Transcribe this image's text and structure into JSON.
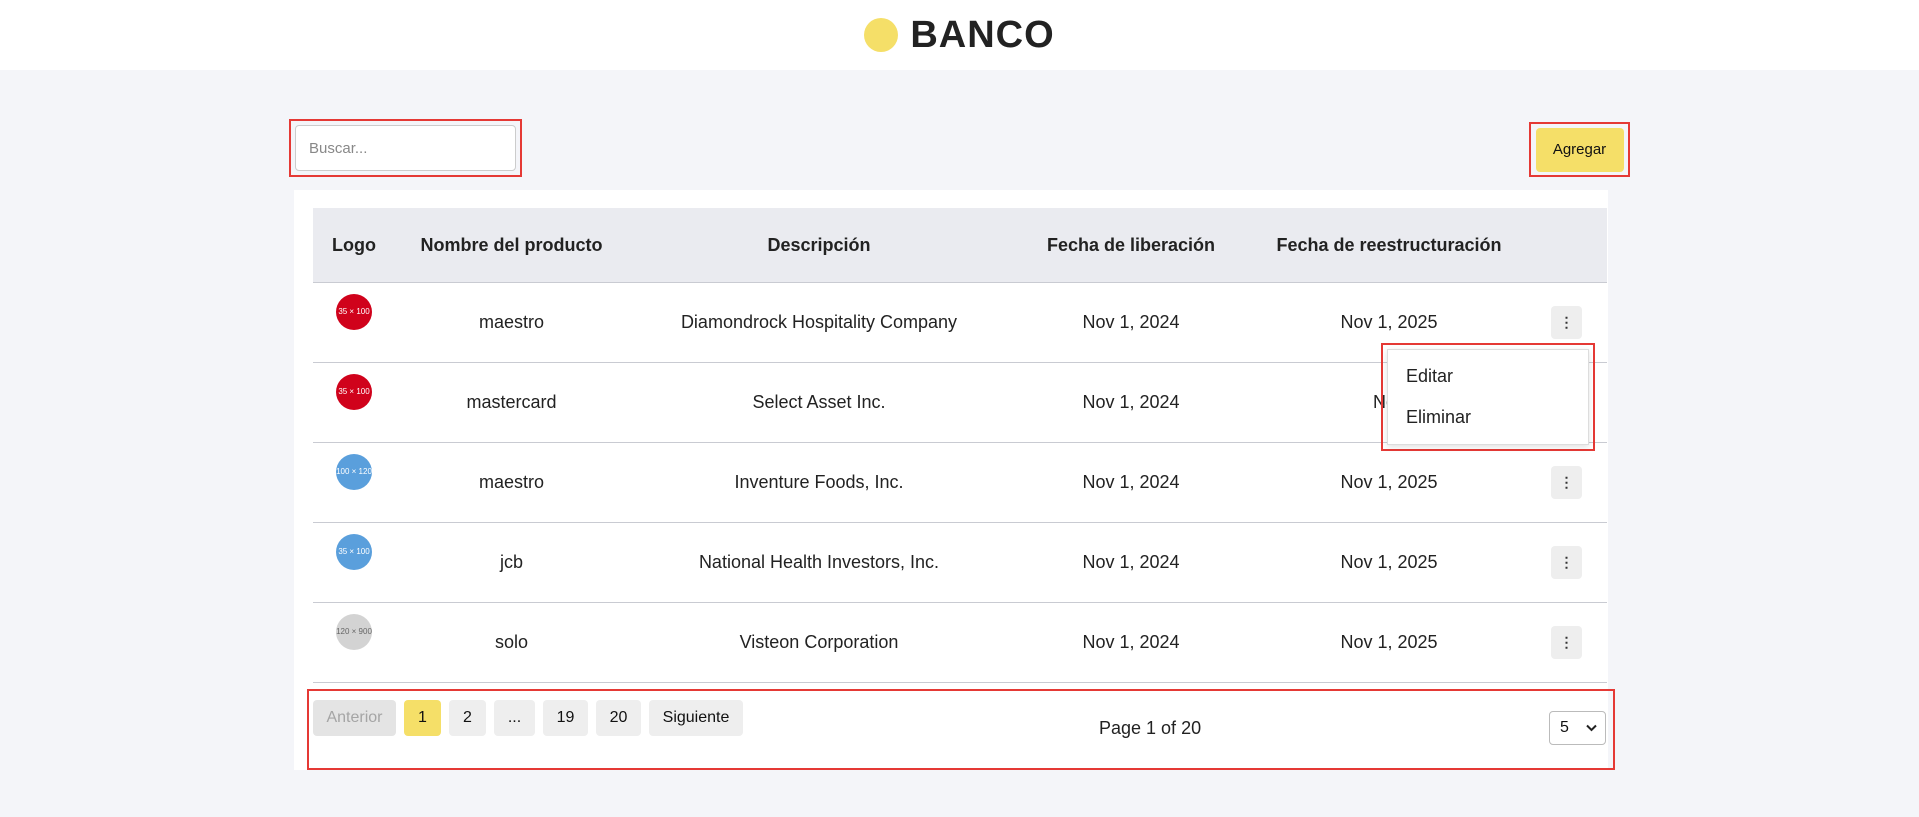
{
  "header": {
    "brand": "BANCO",
    "brand_icon": "logo-dot-icon"
  },
  "search": {
    "placeholder": "Buscar..."
  },
  "toolbar": {
    "add_label": "Agregar"
  },
  "table": {
    "columns": [
      "Logo",
      "Nombre del producto",
      "Descripción",
      "Fecha de liberación",
      "Fecha de reestructuración",
      ""
    ],
    "rows": [
      {
        "logo_color": "#d0021b",
        "logo_text": "35 × 100",
        "name": "maestro",
        "description": "Diamondrock Hospitality Company",
        "release": "Nov 1, 2024",
        "restructure": "Nov 1, 2025"
      },
      {
        "logo_color": "#d0021b",
        "logo_text": "35 × 100",
        "name": "mastercard",
        "description": "Select Asset Inc.",
        "release": "Nov 1, 2024",
        "restructure": "Nov"
      },
      {
        "logo_color": "#5a9fdc",
        "logo_text": "100 × 120",
        "name": "maestro",
        "description": "Inventure Foods, Inc.",
        "release": "Nov 1, 2024",
        "restructure": "Nov 1, 2025"
      },
      {
        "logo_color": "#5a9fdc",
        "logo_text": "35 × 100",
        "name": "jcb",
        "description": "National Health Investors, Inc.",
        "release": "Nov 1, 2024",
        "restructure": "Nov 1, 2025"
      },
      {
        "logo_color": "#d3d3d3",
        "logo_text": "120 × 900",
        "name": "solo",
        "description": "Visteon Corporation",
        "release": "Nov 1, 2024",
        "restructure": "Nov 1, 2025"
      }
    ],
    "row_menu_icon": "more-vertical-icon",
    "row_menu_glyph": "⋮"
  },
  "dropdown": {
    "items": [
      "Editar",
      "Eliminar"
    ]
  },
  "pagination": {
    "prev": "Anterior",
    "pages": [
      "1",
      "2",
      "...",
      "19",
      "20"
    ],
    "current": "1",
    "next": "Siguiente",
    "info": "Page 1 of 20",
    "page_size": "5",
    "page_size_icon": "chevron-down-icon"
  },
  "colors": {
    "accent": "#f5df68",
    "highlight_frame": "#e53935",
    "background": "#f4f5f9"
  }
}
